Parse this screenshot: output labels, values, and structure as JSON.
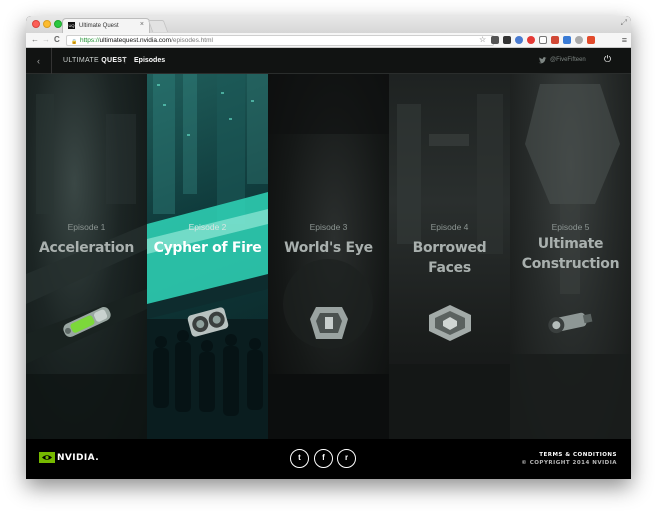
{
  "browser": {
    "tab_title": "Ultimate Quest",
    "tab_favicon_text": "UQ",
    "close_glyph": "×",
    "url_scheme": "https://",
    "url_host": "ultimatequest.nvidia.com",
    "url_path": "/episodes.html",
    "back_glyph": "←",
    "forward_glyph": "→",
    "reload_glyph": "C",
    "lock_glyph": "🔒",
    "star_glyph": "☆",
    "menu_glyph": "≡",
    "resize_glyph": "⤢"
  },
  "header": {
    "back_glyph": "‹",
    "brand_light": "ULTIMATE ",
    "brand_bold": "QUEST",
    "separator": "|",
    "breadcrumb": "Episodes",
    "twitter_handle": "@FiveFifteen",
    "power_glyph": "⏻"
  },
  "episodes": [
    {
      "number": "Episode 1",
      "title": "Acceleration",
      "icon": "green-capsule-icon"
    },
    {
      "number": "Episode 2",
      "title": "Cypher of Fire",
      "icon": "dual-lens-device-icon"
    },
    {
      "number": "Episode 3",
      "title": "World's Eye",
      "icon": "armor-module-icon"
    },
    {
      "number": "Episode 4",
      "title": "Borrowed Faces",
      "icon": "hex-panel-icon"
    },
    {
      "number": "Episode 5",
      "title": "Ultimate Construction",
      "icon": "turbine-part-icon"
    }
  ],
  "footer": {
    "brand": "NVIDIA.",
    "social": [
      {
        "icon": "twitter-icon",
        "glyph": "t"
      },
      {
        "icon": "facebook-icon",
        "glyph": "f"
      },
      {
        "icon": "reddit-icon",
        "glyph": "r"
      }
    ],
    "terms": "TERMS & CONDITIONS",
    "copyright": "© COPYRIGHT 2014 NVIDIA"
  },
  "colors": {
    "accent": "#76b900",
    "episode2_highlight": "#2fd6b8"
  }
}
